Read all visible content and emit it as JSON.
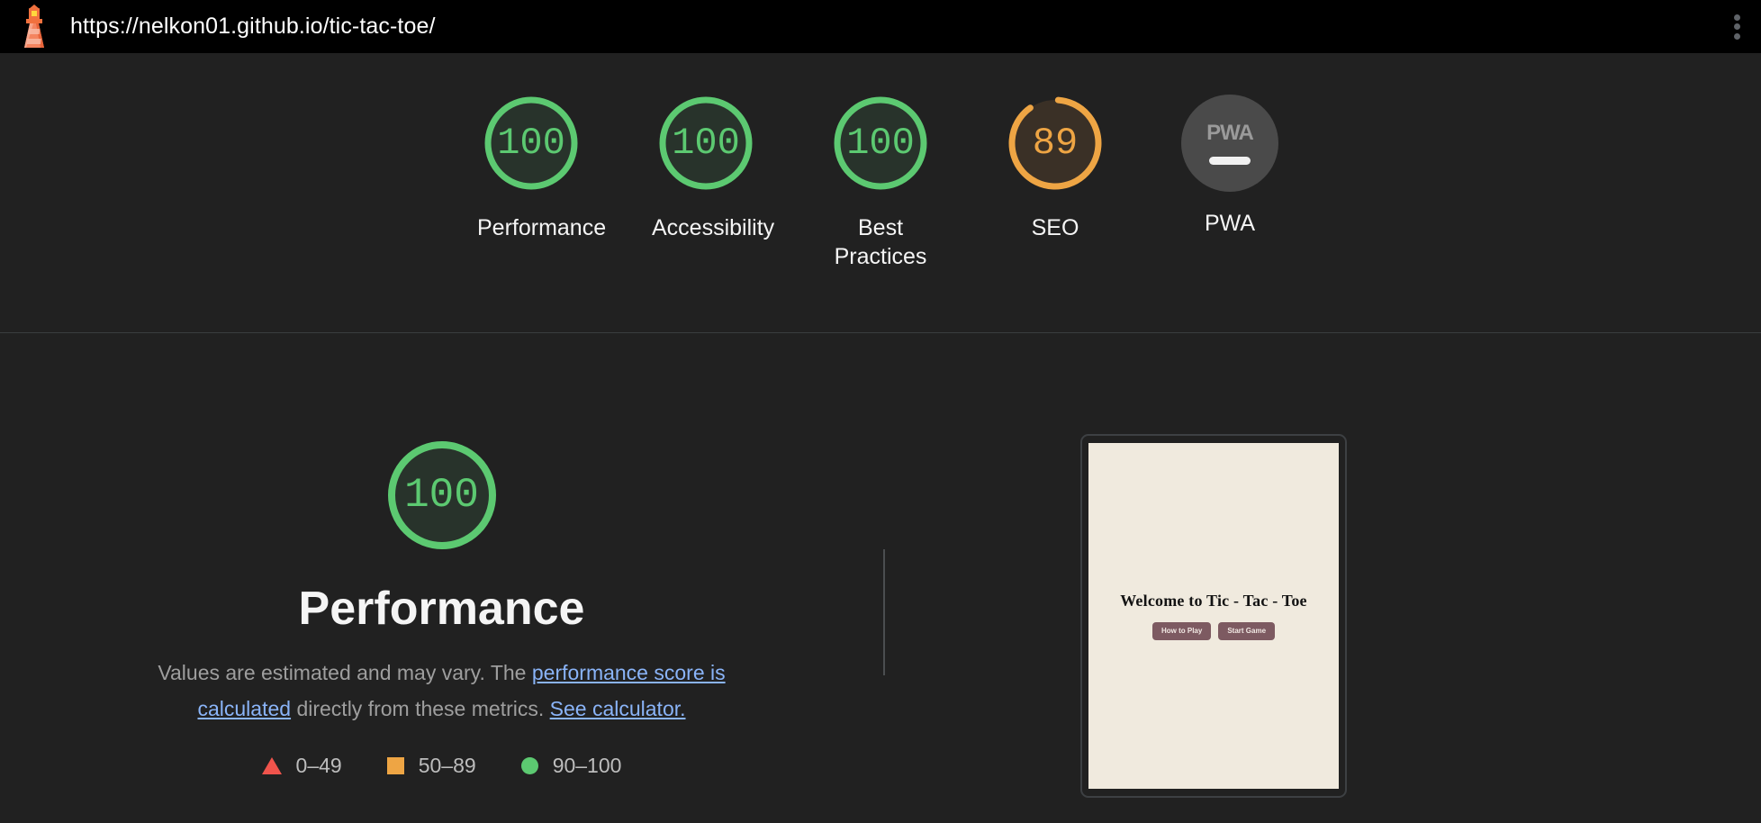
{
  "header": {
    "icon": "lighthouse-icon",
    "url": "https://nelkon01.github.io/tic-tac-toe/",
    "menu_icon": "kebab-menu-icon"
  },
  "scores": {
    "categories": [
      {
        "label": "Performance",
        "value": "100",
        "pct": 100,
        "state": "pass",
        "type": "gauge"
      },
      {
        "label": "Accessibility",
        "value": "100",
        "pct": 100,
        "state": "pass",
        "type": "gauge"
      },
      {
        "label": "Best Practices",
        "value": "100",
        "pct": 100,
        "state": "pass",
        "type": "gauge"
      },
      {
        "label": "SEO",
        "value": "89",
        "pct": 89,
        "state": "average",
        "type": "gauge"
      },
      {
        "label": "PWA",
        "value": "PWA",
        "pct": 0,
        "state": "null",
        "type": "badge"
      }
    ]
  },
  "detail": {
    "score": "100",
    "title": "Performance",
    "desc_part1": "Values are estimated and may vary. The ",
    "link1": "performance score is calculated",
    "desc_part2": " directly from these metrics. ",
    "link2": "See calculator.",
    "legend": [
      {
        "shape": "triangle",
        "range": "0–49",
        "color": "#f0544c"
      },
      {
        "shape": "square",
        "range": "50–89",
        "color": "#eea544"
      },
      {
        "shape": "circle",
        "range": "90–100",
        "color": "#5cc971"
      }
    ]
  },
  "thumbnail": {
    "heading": "Welcome to Tic - Tac - Toe",
    "buttons": [
      "How to Play",
      "Start Game"
    ]
  },
  "colors": {
    "pass": "#5cc971",
    "average": "#eea544",
    "fail": "#f0544c",
    "link": "#8ab4f8",
    "background": "#212121",
    "topbar": "#000000"
  }
}
